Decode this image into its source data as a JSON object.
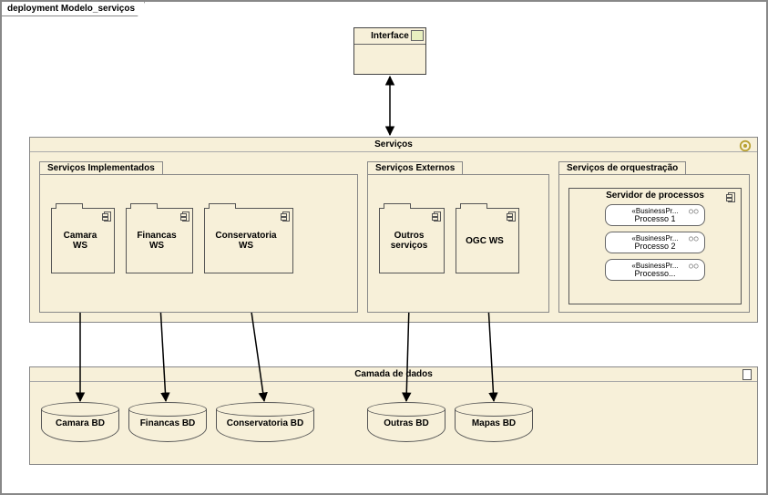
{
  "diagram_title": "deployment Modelo_serviços",
  "interface": {
    "label": "Interface"
  },
  "services": {
    "title": "Serviços",
    "implemented": {
      "tab": "Serviços Implementados",
      "components": [
        {
          "name": "Camara WS"
        },
        {
          "name": "Financas WS"
        },
        {
          "name": "Conservatoria WS"
        }
      ]
    },
    "external": {
      "tab": "Serviços Externos",
      "components": [
        {
          "name": "Outros serviços"
        },
        {
          "name": "OGC WS"
        }
      ]
    },
    "orchestration": {
      "tab": "Serviços de orquestração",
      "server": {
        "title": "Servidor de processos",
        "processes": [
          {
            "stereotype": "«BusinessPr...",
            "name": "Processo 1"
          },
          {
            "stereotype": "«BusinessPr...",
            "name": "Processo 2"
          },
          {
            "stereotype": "«BusinessPr...",
            "name": "Processo..."
          }
        ]
      }
    }
  },
  "data_layer": {
    "title": "Camada de dados",
    "databases": [
      {
        "name": "Camara BD"
      },
      {
        "name": "Financas BD"
      },
      {
        "name": "Conservatoria BD"
      },
      {
        "name": "Outras BD"
      },
      {
        "name": "Mapas BD"
      }
    ]
  },
  "connectors": [
    {
      "from": "interface",
      "to": "services",
      "bidirectional": true
    },
    {
      "from": "camara-ws",
      "to": "camara-bd",
      "bidirectional": true
    },
    {
      "from": "financas-ws",
      "to": "financas-bd",
      "bidirectional": true
    },
    {
      "from": "conservatoria-ws",
      "to": "conservatoria-bd",
      "bidirectional": true
    },
    {
      "from": "outros-servicos",
      "to": "outras-bd",
      "bidirectional": true
    },
    {
      "from": "ogc-ws",
      "to": "mapas-bd",
      "bidirectional": true
    }
  ]
}
